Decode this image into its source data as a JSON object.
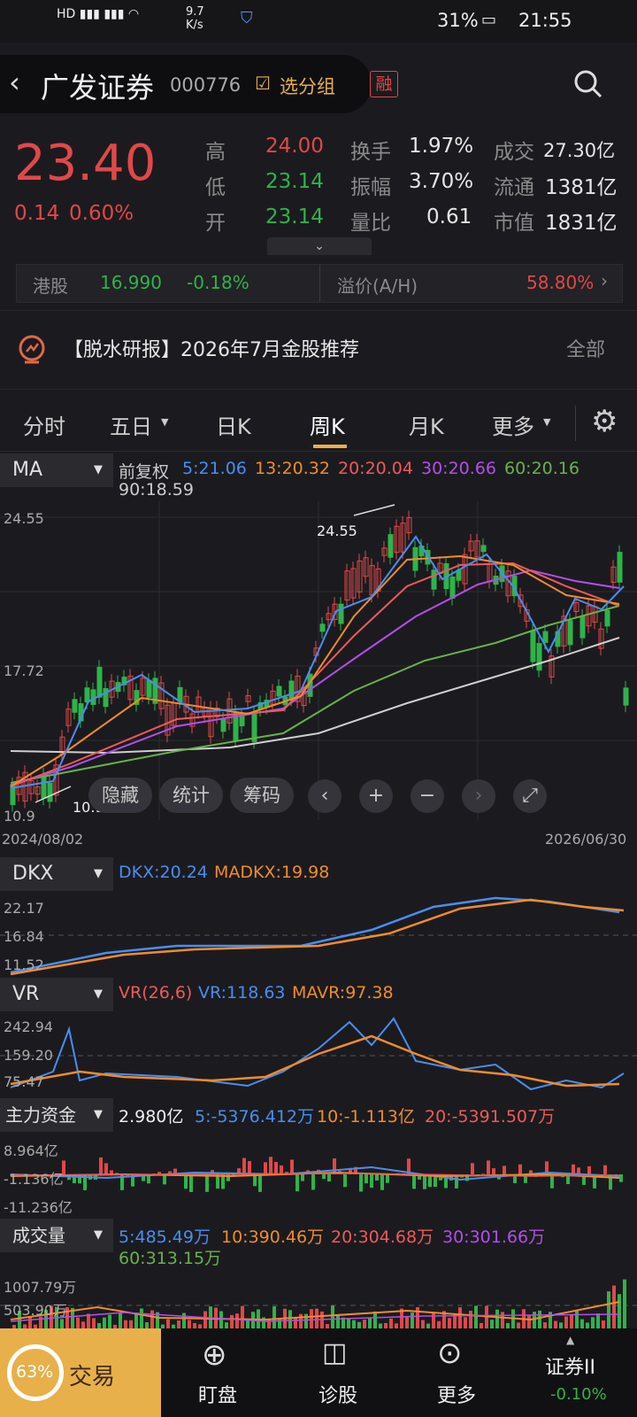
{
  "status": {
    "network": "9.7\nK/s",
    "battery": "31%",
    "time": "21:55"
  },
  "header": {
    "name": "广发证券",
    "code": "000776",
    "group": "选分组",
    "badge": "融"
  },
  "quote": {
    "price": "23.40",
    "change": "0.14",
    "pct": "0.60%",
    "rows": [
      {
        "l1": "高",
        "v1": "24.00",
        "l2": "换手",
        "v2": "1.97%",
        "l3": "成交",
        "v3": "27.30亿"
      },
      {
        "l1": "低",
        "v1": "23.14",
        "l2": "振幅",
        "v2": "3.70%",
        "l3": "流通",
        "v3": "1381亿"
      },
      {
        "l1": "开",
        "v1": "23.14",
        "l2": "量比",
        "v2": "0.61",
        "l3": "市值",
        "v3": "1831亿"
      }
    ]
  },
  "hk": {
    "label": "港股",
    "price": "16.990",
    "pct": "-0.18%",
    "premium_label": "溢价(A/H)",
    "premium": "58.80%"
  },
  "news": {
    "text": "【脱水研报】2026年7月金股推荐",
    "more": "全部"
  },
  "tabs": [
    "分时",
    "五日",
    "日K",
    "周K",
    "月K",
    "更多"
  ],
  "ma": {
    "label": "MA",
    "adj": "前复权",
    "items": [
      {
        "text": "5:21.06",
        "color": "#4a8df0"
      },
      {
        "text": "13:20.32",
        "color": "#f08c2c"
      },
      {
        "text": "20:20.04",
        "color": "#ef5a5a"
      },
      {
        "text": "30:20.66",
        "color": "#b44ee8"
      },
      {
        "text": "60:20.16",
        "color": "#6ab04c"
      }
    ],
    "ma90": "90:18.59",
    "y_top": "24.55",
    "y_mid": "17.72",
    "y_low": "10.9",
    "hi_mark": "24.55",
    "lo_mark": "10.90",
    "date_start": "2024/08/02",
    "date_end": "2026/06/30",
    "buttons": [
      "隐藏",
      "统计",
      "筹码"
    ]
  },
  "dkx": {
    "label": "DKX",
    "v1": "DKX:20.24",
    "v2": "MADKX:19.98",
    "y1": "22.17",
    "y2": "16.84",
    "y3": "11.52"
  },
  "vr": {
    "label": "VR",
    "v0": "VR(26,6)",
    "v1": "VR:118.63",
    "v2": "MAVR:97.38",
    "y1": "242.94",
    "y2": "159.20",
    "y3": "75.47"
  },
  "zl": {
    "label": "主力资金",
    "v0": "2.980亿",
    "v1": "5:-5376.412万",
    "v2": "10:-1.113亿",
    "v3": "20:-5391.507万",
    "y1": "8.964亿",
    "y2": "-1.136亿",
    "y3": "-11.236亿"
  },
  "vol": {
    "label": "成交量",
    "v1": "5:485.49万",
    "v2": "10:390.46万",
    "v3": "20:304.68万",
    "v4": "30:301.66万",
    "v5": "60:313.15万",
    "y1": "1007.79万",
    "y2": "503.90万"
  },
  "bottom": {
    "progress": "63%",
    "trade": "交易",
    "watch": "盯盘",
    "diag": "诊股",
    "more": "更多",
    "index": "证券II",
    "index_pct": "-0.10%"
  }
}
